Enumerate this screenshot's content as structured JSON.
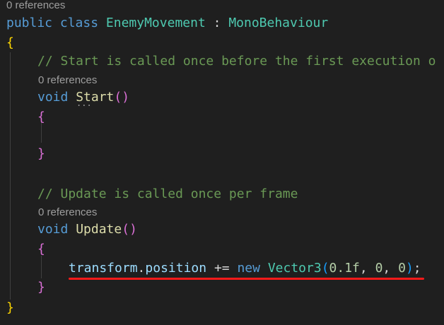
{
  "colors": {
    "background": "#1f1f1f",
    "keyword": "#569cd6",
    "type": "#4ec9b0",
    "function": "#dcdcaa",
    "variable": "#9cdcfe",
    "number": "#b5cea8",
    "comment": "#6a9955",
    "codelens": "#9e9e9e",
    "highlight_underline": "#ff1a1a"
  },
  "codelens": {
    "class_refs": "0 references",
    "start_refs": "0 references",
    "update_refs": "0 references"
  },
  "code": {
    "class_line": {
      "kw_public": "public",
      "kw_class": "class",
      "class_name": "EnemyMovement",
      "colon": ":",
      "base_class": "MonoBehaviour"
    },
    "open_brace": "{",
    "comment_start": "// Start is called once before the first execution o",
    "start_line": {
      "kw_void": "void",
      "method_name": "Start",
      "open_paren": "(",
      "close_paren": ")"
    },
    "start_open_brace": "{",
    "start_close_brace": "}",
    "comment_update": "// Update is called once per frame",
    "update_line": {
      "kw_void": "void",
      "method_name": "Update",
      "open_paren": "(",
      "close_paren": ")"
    },
    "update_open_brace": "{",
    "statement": {
      "object": "transform",
      "dot": ".",
      "member": "position",
      "operator": "+=",
      "kw_new": "new",
      "type": "Vector3",
      "open_paren": "(",
      "arg1": "0.1f",
      "comma1": ",",
      "arg2": "0",
      "comma2": ",",
      "arg3": "0",
      "close_paren": ")",
      "semicolon": ";"
    },
    "update_close_brace": "}",
    "close_brace": "}"
  },
  "hint_dots": "..."
}
